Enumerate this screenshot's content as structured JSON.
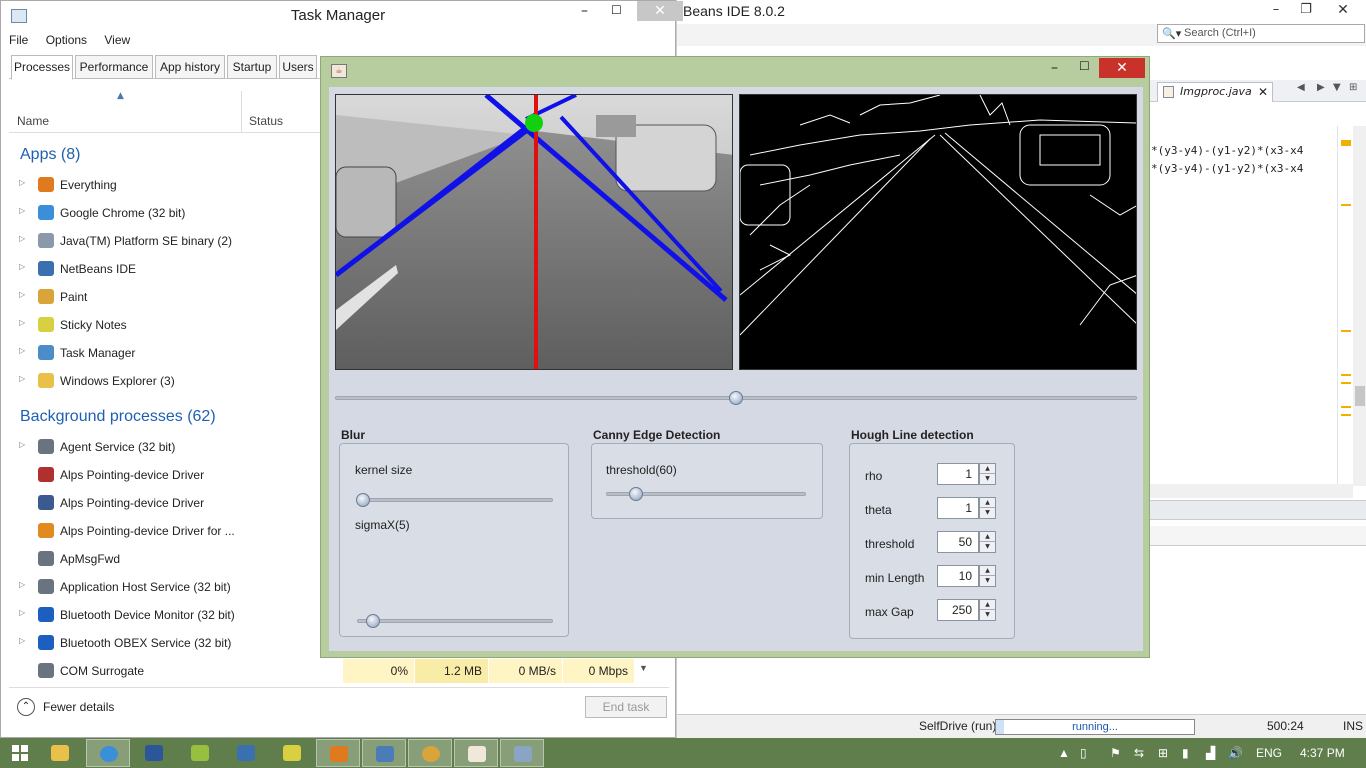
{
  "netbeans": {
    "title": "Beans IDE 8.0.2",
    "search_placeholder": "Search (Ctrl+I)",
    "file_tab": "Imgproc.java",
    "code_lines": [
      "*(y3-y4)-(y1-y2)*(x3-x4",
      "*(y3-y4)-(y1-y2)*(x3-x4"
    ],
    "status": {
      "run_label": "SelfDrive (run)",
      "progress_text": "running...",
      "progress_fraction": 0.04,
      "position": "500:24",
      "mode": "INS"
    }
  },
  "taskmanager": {
    "title": "Task Manager",
    "menu": [
      "File",
      "Options",
      "View"
    ],
    "tabs": [
      "Processes",
      "Performance",
      "App history",
      "Startup",
      "Users"
    ],
    "active_tab": "Processes",
    "columns": {
      "name": "Name",
      "status": "Status"
    },
    "apps_header": "Apps (8)",
    "apps": [
      {
        "name": "Everything",
        "color": "#e07a1f"
      },
      {
        "name": "Google Chrome (32 bit)",
        "color": "#3b8ed8"
      },
      {
        "name": "Java(TM) Platform SE binary (2)",
        "color": "#8a9aab"
      },
      {
        "name": "NetBeans IDE",
        "color": "#3a6fb0"
      },
      {
        "name": "Paint",
        "color": "#d9a43a"
      },
      {
        "name": "Sticky Notes",
        "color": "#d8d040"
      },
      {
        "name": "Task Manager",
        "color": "#4c8cc8"
      },
      {
        "name": "Windows Explorer (3)",
        "color": "#e8c04a"
      }
    ],
    "bg_header": "Background processes (62)",
    "background": [
      {
        "name": "Agent Service (32 bit)",
        "color": "#6a7480",
        "expandable": true
      },
      {
        "name": "Alps Pointing-device Driver",
        "color": "#b03030",
        "expandable": false
      },
      {
        "name": "Alps Pointing-device Driver",
        "color": "#3a5a90",
        "expandable": false
      },
      {
        "name": "Alps Pointing-device Driver for ...",
        "color": "#e08a20",
        "expandable": false
      },
      {
        "name": "ApMsgFwd",
        "color": "#6a7480",
        "expandable": false
      },
      {
        "name": "Application Host Service (32 bit)",
        "color": "#6a7480",
        "expandable": true
      },
      {
        "name": "Bluetooth Device Monitor (32 bit)",
        "color": "#1c5fc0",
        "expandable": true
      },
      {
        "name": "Bluetooth OBEX Service (32 bit)",
        "color": "#1c5fc0",
        "expandable": true
      },
      {
        "name": "COM Surrogate",
        "color": "#6a7480",
        "expandable": false
      }
    ],
    "metrics": [
      "0%",
      "1.2 MB",
      "0 MB/s",
      "0 Mbps"
    ],
    "fewer_details": "Fewer details",
    "end_task": "End task"
  },
  "javaapp": {
    "blur": {
      "title": "Blur",
      "kernel_label": "kernel size",
      "kernel_value": 0.03,
      "sigma_label": "sigmaX(5)",
      "sigma_value": 0.08
    },
    "canny": {
      "title": "Canny Edge Detection",
      "threshold_label": "threshold(60)",
      "threshold_value": 0.15
    },
    "hough": {
      "title": "Hough Line detection",
      "params": [
        {
          "label": "rho",
          "value": "1"
        },
        {
          "label": "theta",
          "value": "1"
        },
        {
          "label": "threshold",
          "value": "50"
        },
        {
          "label": "min Length",
          "value": "10"
        },
        {
          "label": "max Gap",
          "value": "250"
        }
      ]
    },
    "video_position": 0.5
  },
  "taskbar": {
    "lang": "ENG",
    "time": "4:37 PM"
  }
}
